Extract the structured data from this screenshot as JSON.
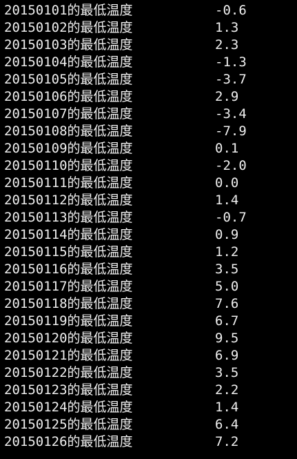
{
  "terminal": {
    "background": "#000000",
    "text_color": "#f0f0f0",
    "rows": [
      {
        "label": "20150101的最低温度",
        "value": "-0.6"
      },
      {
        "label": "20150102的最低温度",
        "value": "1.3"
      },
      {
        "label": "20150103的最低温度",
        "value": "2.3"
      },
      {
        "label": "20150104的最低温度",
        "value": "-1.3"
      },
      {
        "label": "20150105的最低温度",
        "value": "-3.7"
      },
      {
        "label": "20150106的最低温度",
        "value": "2.9"
      },
      {
        "label": "20150107的最低温度",
        "value": "-3.4"
      },
      {
        "label": "20150108的最低温度",
        "value": "-7.9"
      },
      {
        "label": "20150109的最低温度",
        "value": "0.1"
      },
      {
        "label": "20150110的最低温度",
        "value": "-2.0"
      },
      {
        "label": "20150111的最低温度",
        "value": "0.0"
      },
      {
        "label": "20150112的最低温度",
        "value": "1.4"
      },
      {
        "label": "20150113的最低温度",
        "value": "-0.7"
      },
      {
        "label": "20150114的最低温度",
        "value": "0.9"
      },
      {
        "label": "20150115的最低温度",
        "value": "1.2"
      },
      {
        "label": "20150116的最低温度",
        "value": "3.5"
      },
      {
        "label": "20150117的最低温度",
        "value": "5.0"
      },
      {
        "label": "20150118的最低温度",
        "value": "7.6"
      },
      {
        "label": "20150119的最低温度",
        "value": "6.7"
      },
      {
        "label": "20150120的最低温度",
        "value": "9.5"
      },
      {
        "label": "20150121的最低温度",
        "value": "6.9"
      },
      {
        "label": "20150122的最低温度",
        "value": "3.5"
      },
      {
        "label": "20150123的最低温度",
        "value": "2.2"
      },
      {
        "label": "20150124的最低温度",
        "value": "1.4"
      },
      {
        "label": "20150125的最低温度",
        "value": "6.4"
      },
      {
        "label": "20150126的最低温度",
        "value": "7.2"
      }
    ]
  }
}
